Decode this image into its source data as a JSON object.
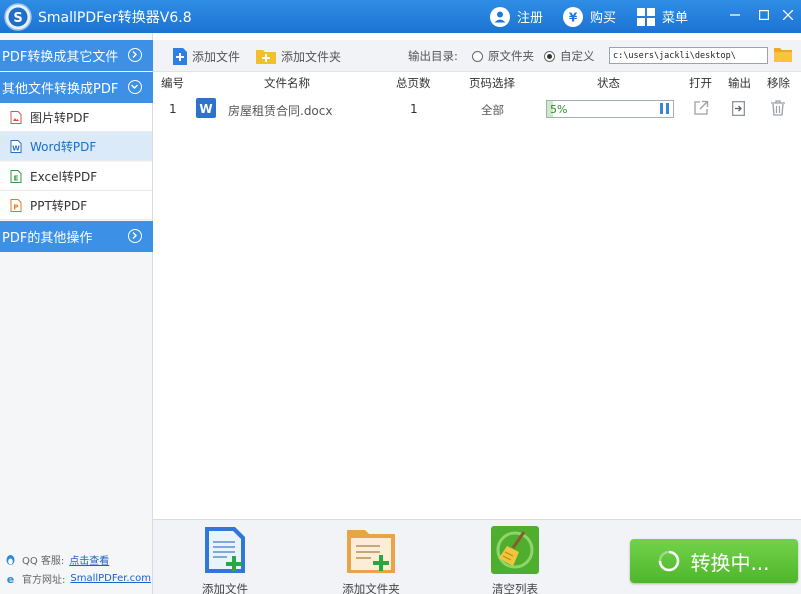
{
  "app": {
    "title": "SmallPDFer转换器V6.8"
  },
  "titlebar": {
    "register": "注册",
    "buy": "购买",
    "menu": "菜单"
  },
  "sidebar": {
    "sections": [
      {
        "label": "PDF转换成其它文件"
      },
      {
        "label": "其他文件转换成PDF"
      },
      {
        "label": "PDF的其他操作"
      }
    ],
    "items": [
      {
        "label": "图片转PDF",
        "icon": "image-file-icon"
      },
      {
        "label": "Word转PDF",
        "icon": "word-file-icon",
        "active": true
      },
      {
        "label": "Excel转PDF",
        "icon": "excel-file-icon"
      },
      {
        "label": "PPT转PDF",
        "icon": "ppt-file-icon"
      }
    ],
    "support_label": "QQ 客服:",
    "support_link": "点击查看",
    "website_label": "官方网址:",
    "website_link": "SmallPDFer.com"
  },
  "toolbar": {
    "add_file": "添加文件",
    "add_folder": "添加文件夹",
    "output_label": "输出目录:",
    "radio_original": "原文件夹",
    "radio_custom": "自定义",
    "selected_radio": "custom",
    "output_path": "c:\\users\\jackli\\desktop\\"
  },
  "table": {
    "headers": {
      "num": "编号",
      "name": "文件名称",
      "pages": "总页数",
      "range": "页码选择",
      "status": "状态",
      "open": "打开",
      "output": "输出",
      "remove": "移除"
    },
    "rows": [
      {
        "num": "1",
        "name": "房屋租赁合同.docx",
        "pages": "1",
        "range": "全部",
        "progress_text": "5%",
        "progress": 0.05
      }
    ]
  },
  "bottom": {
    "add_file": "添加文件",
    "add_folder": "添加文件夹",
    "clear_list": "清空列表",
    "convert": "转换中..."
  },
  "colors": {
    "titlebar": "#1f78d8",
    "sidebar_header": "#3c91e6",
    "convert_button": "#5cc236",
    "progress_fill": "#cdeac6"
  }
}
